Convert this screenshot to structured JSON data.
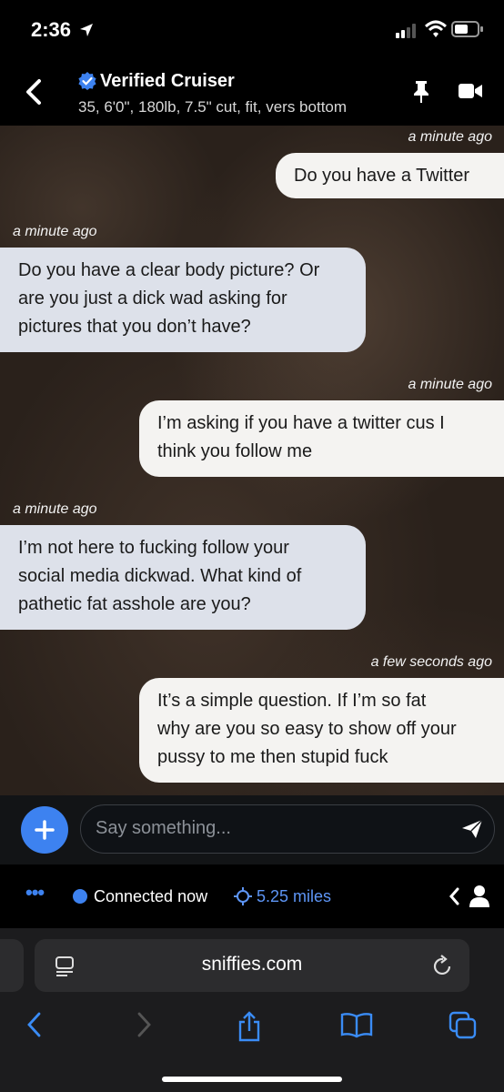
{
  "status_bar": {
    "time": "2:36"
  },
  "header": {
    "name": "Verified Cruiser",
    "stats": "35, 6'0\", 180lb, 7.5\" cut, fit, vers bottom"
  },
  "messages": [
    {
      "from": "me",
      "time": "a minute ago",
      "lines": [
        "Do you have a Twitter"
      ]
    },
    {
      "from": "them",
      "time": "a minute ago",
      "lines": [
        "Do you have a clear body picture? Or",
        "are you just a dick wad asking for",
        "pictures that you don’t have?"
      ]
    },
    {
      "from": "me",
      "time": "a minute ago",
      "lines": [
        "I’m asking if you have a twitter cus I",
        "think you follow me"
      ]
    },
    {
      "from": "them",
      "time": "a minute ago",
      "lines": [
        "I’m not here to fucking follow your",
        "social media dickwad. What kind of",
        "pathetic fat asshole are you?"
      ]
    },
    {
      "from": "me",
      "time": "a few seconds ago",
      "lines": [
        "It’s a simple question. If I’m so fat",
        "why are you so easy to show off your",
        "pussy to me then stupid fuck"
      ]
    }
  ],
  "composer": {
    "placeholder": "Say something...",
    "plus_label": "+"
  },
  "status_row": {
    "dots": "•••",
    "connected": "Connected now",
    "distance": "5.25 miles"
  },
  "browser": {
    "url": "sniffies.com"
  },
  "colors": {
    "accent": "#3d82f0",
    "my_bubble": "#f4f3f1",
    "their_bubble": "#dde1ea",
    "browser_blue": "#3a8cf6"
  }
}
